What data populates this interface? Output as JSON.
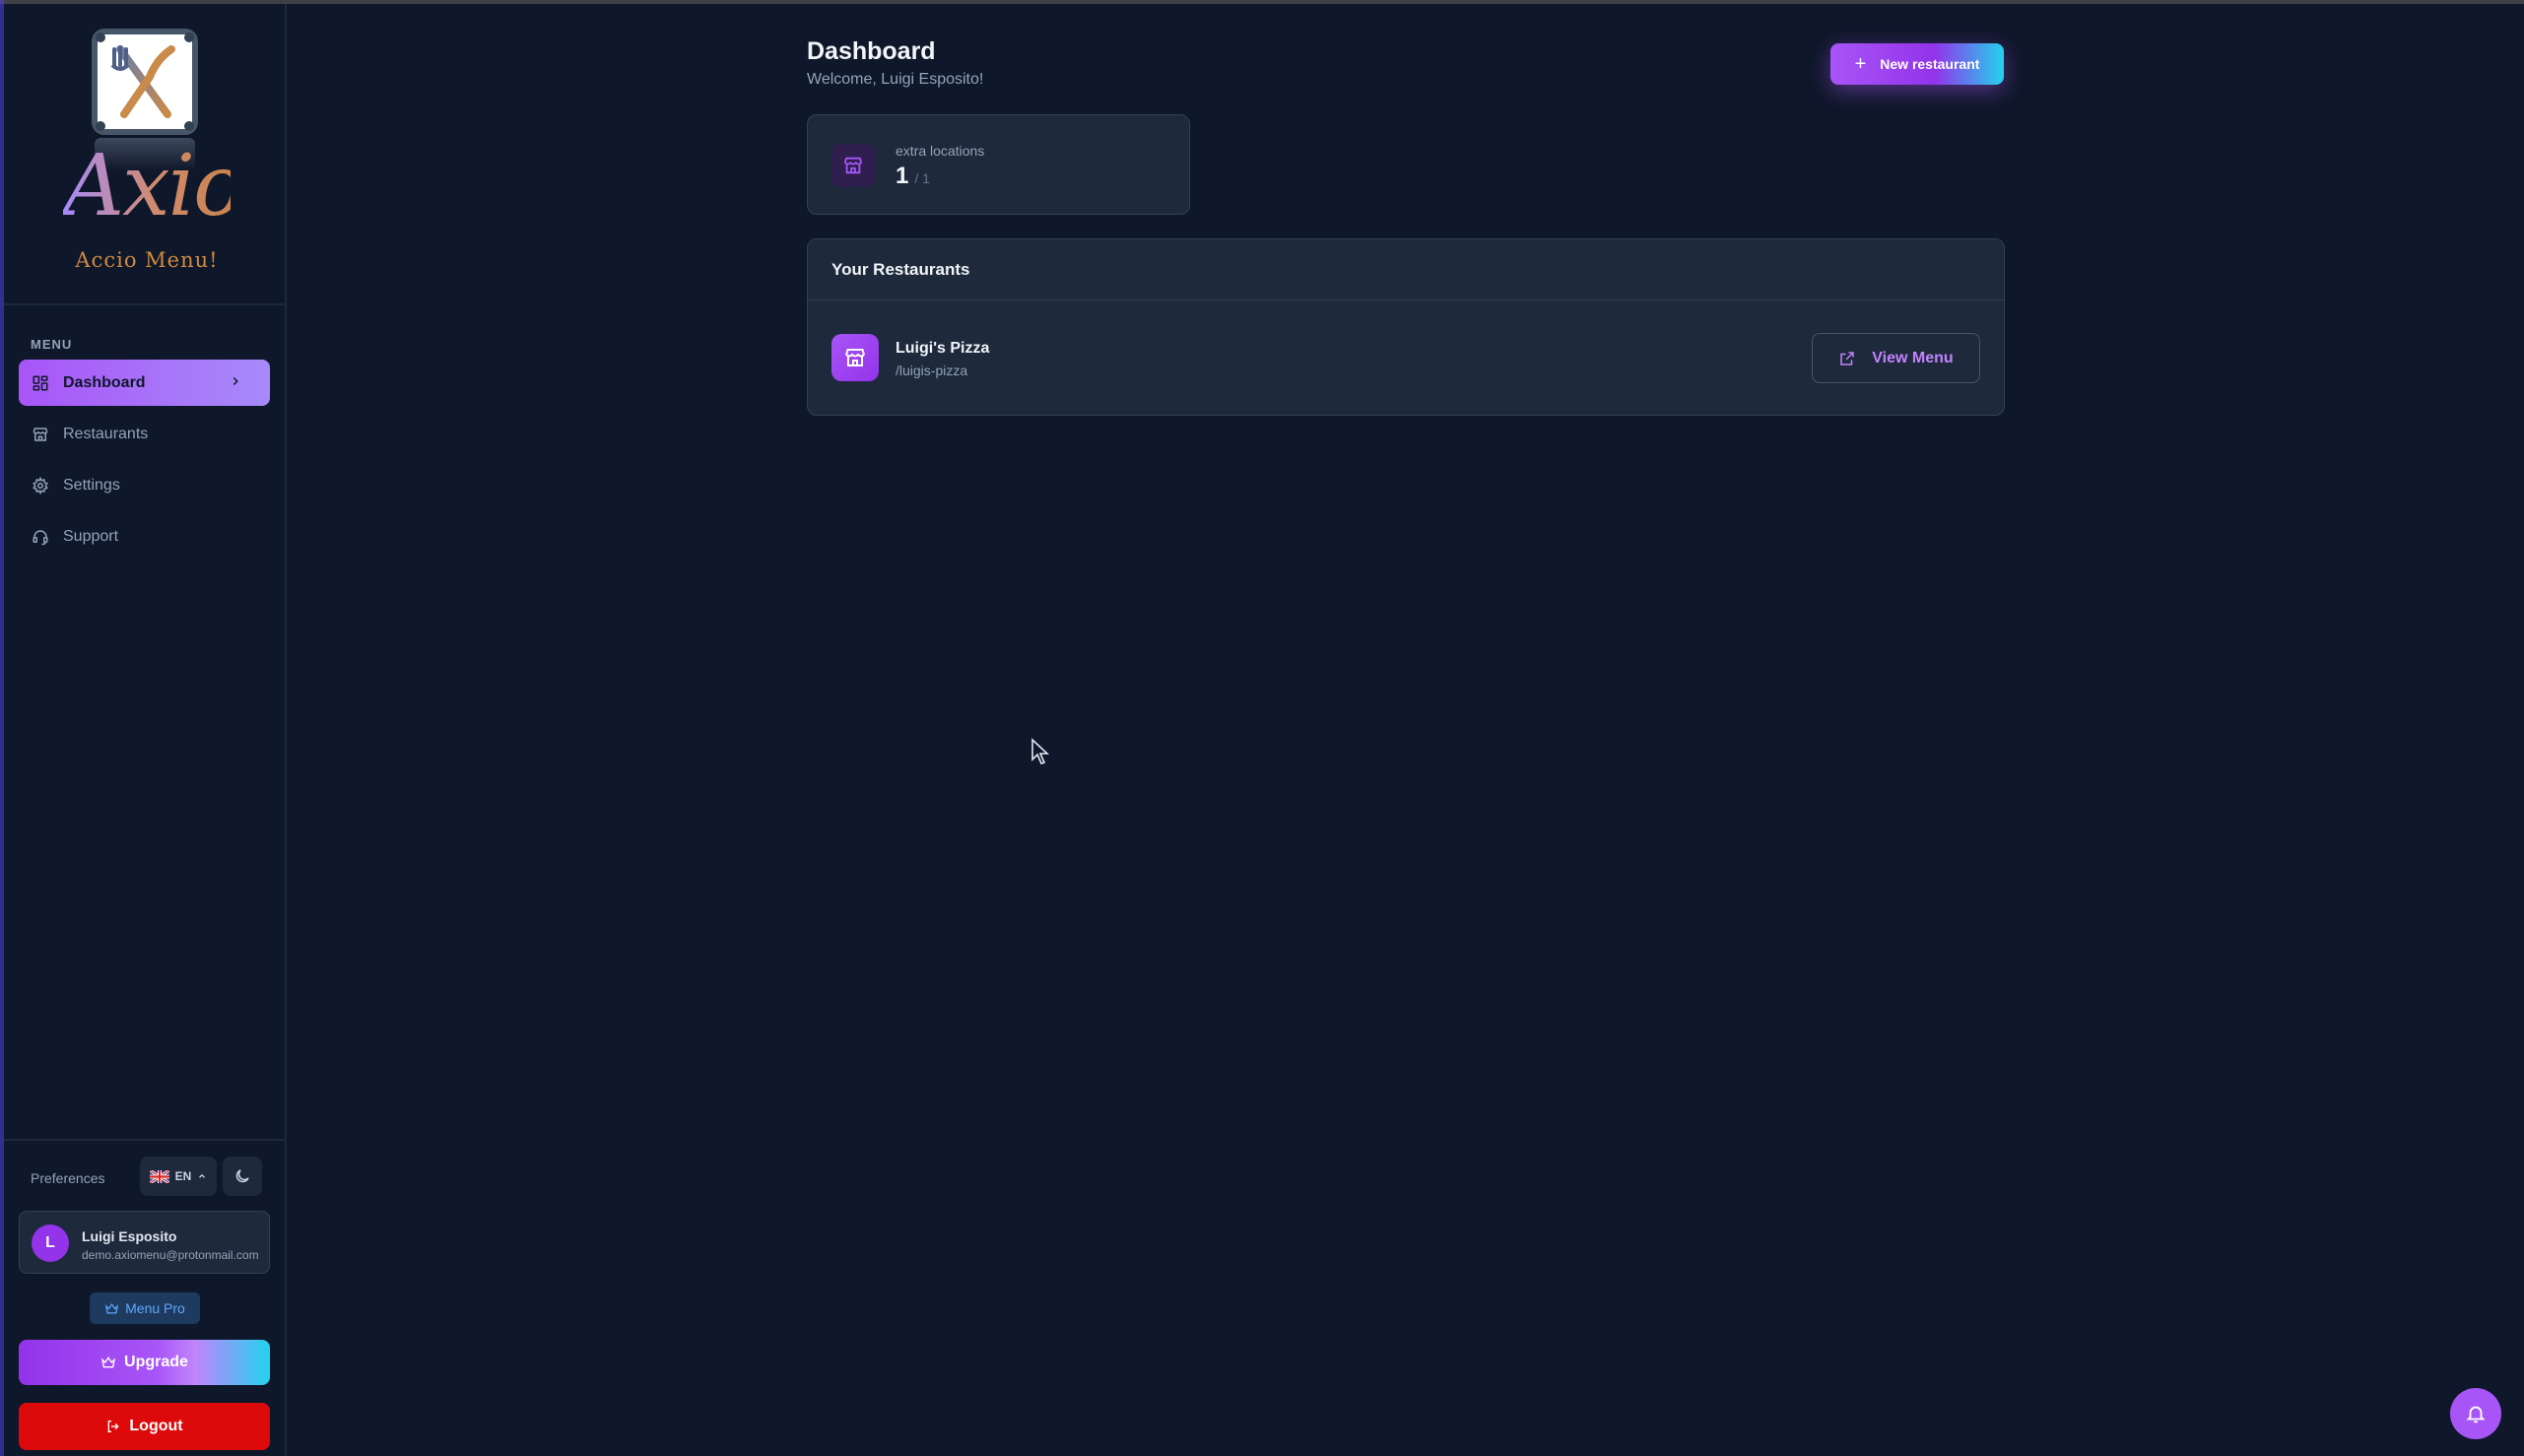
{
  "brand": {
    "name": "Axio",
    "tagline": "Accio Menu!"
  },
  "sidebar": {
    "menu_caption": "MENU",
    "items": [
      {
        "label": "Dashboard",
        "icon": "dashboard-icon",
        "active": true
      },
      {
        "label": "Restaurants",
        "icon": "store-icon",
        "active": false
      },
      {
        "label": "Settings",
        "icon": "gear-icon",
        "active": false
      },
      {
        "label": "Support",
        "icon": "headset-icon",
        "active": false
      }
    ],
    "preferences_label": "Preferences",
    "language": "EN",
    "user": {
      "initial": "L",
      "name": "Luigi Esposito",
      "email": "demo.axiomenu@protonmail.com"
    },
    "plan": "Menu Pro",
    "upgrade_label": "Upgrade",
    "logout_label": "Logout"
  },
  "main": {
    "title": "Dashboard",
    "subtitle": "Welcome, Luigi Esposito!",
    "new_button": "New restaurant",
    "stat": {
      "label": "extra locations",
      "value": "1",
      "limit": "/ 1"
    },
    "restaurants_title": "Your Restaurants",
    "restaurants": [
      {
        "name": "Luigi's Pizza",
        "slug": "/luigis-pizza",
        "action": "View Menu"
      }
    ]
  },
  "colors": {
    "background": "#0f172a",
    "panel": "#1e293b",
    "accent": "#a855f7",
    "accent_cyan": "#22d3ee",
    "danger": "#dc0a0a"
  }
}
